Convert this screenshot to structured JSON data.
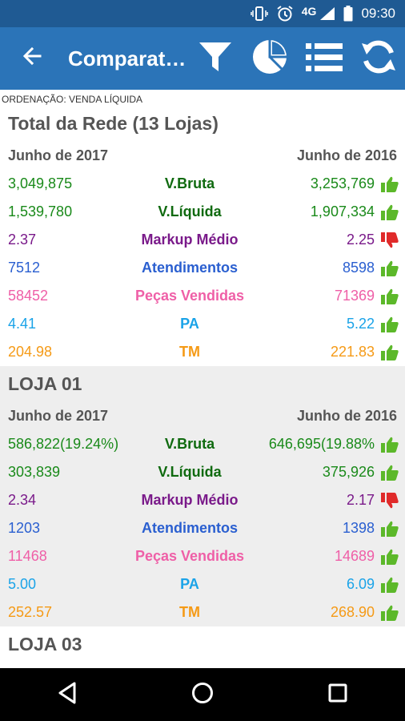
{
  "status_bar": {
    "network": "4G",
    "time": "09:30"
  },
  "app_bar": {
    "title": "Comparat…"
  },
  "ordering_label": "ORDENAÇÃO: VENDA LÍQUIDA",
  "sections": [
    {
      "title": "Total da Rede (13 Lojas)",
      "period_left": "Junho de 2017",
      "period_right": "Junho de 2016",
      "rows": [
        {
          "left": "3,049,875",
          "label": "V.Bruta",
          "right": "3,253,769",
          "thumb": "up"
        },
        {
          "left": "1,539,780",
          "label": "V.Líquida",
          "right": "1,907,334",
          "thumb": "up"
        },
        {
          "left": "2.37",
          "label": "Markup Médio",
          "right": "2.25",
          "thumb": "down"
        },
        {
          "left": "7512",
          "label": "Atendimentos",
          "right": "8598",
          "thumb": "up"
        },
        {
          "left": "58452",
          "label": "Peças Vendidas",
          "right": "71369",
          "thumb": "up"
        },
        {
          "left": "4.41",
          "label": "PA",
          "right": "5.22",
          "thumb": "up"
        },
        {
          "left": "204.98",
          "label": "TM",
          "right": "221.83",
          "thumb": "up"
        }
      ]
    },
    {
      "title": "LOJA 01",
      "period_left": "Junho de 2017",
      "period_right": "Junho de 2016",
      "rows": [
        {
          "left": "586,822(19.24%)",
          "label": "V.Bruta",
          "right": "646,695(19.88%",
          "thumb": "up"
        },
        {
          "left": "303,839",
          "label": "V.Líquida",
          "right": "375,926",
          "thumb": "up"
        },
        {
          "left": "2.34",
          "label": "Markup Médio",
          "right": "2.17",
          "thumb": "down"
        },
        {
          "left": "1203",
          "label": "Atendimentos",
          "right": "1398",
          "thumb": "up"
        },
        {
          "left": "11468",
          "label": "Peças Vendidas",
          "right": "14689",
          "thumb": "up"
        },
        {
          "left": "5.00",
          "label": "PA",
          "right": "6.09",
          "thumb": "up"
        },
        {
          "left": "252.57",
          "label": "TM",
          "right": "268.90",
          "thumb": "up"
        }
      ]
    },
    {
      "title": "LOJA 03"
    }
  ],
  "colors": {
    "app_bar": "#2b74b8",
    "status_bar": "#1f5a93",
    "thumb_up": "#5cb82a",
    "thumb_down": "#e02a2a"
  },
  "icons": {
    "back": "arrow-left-icon",
    "filter": "filter-icon",
    "chart": "pie-chart-icon",
    "list": "list-icon",
    "refresh": "refresh-icon"
  }
}
